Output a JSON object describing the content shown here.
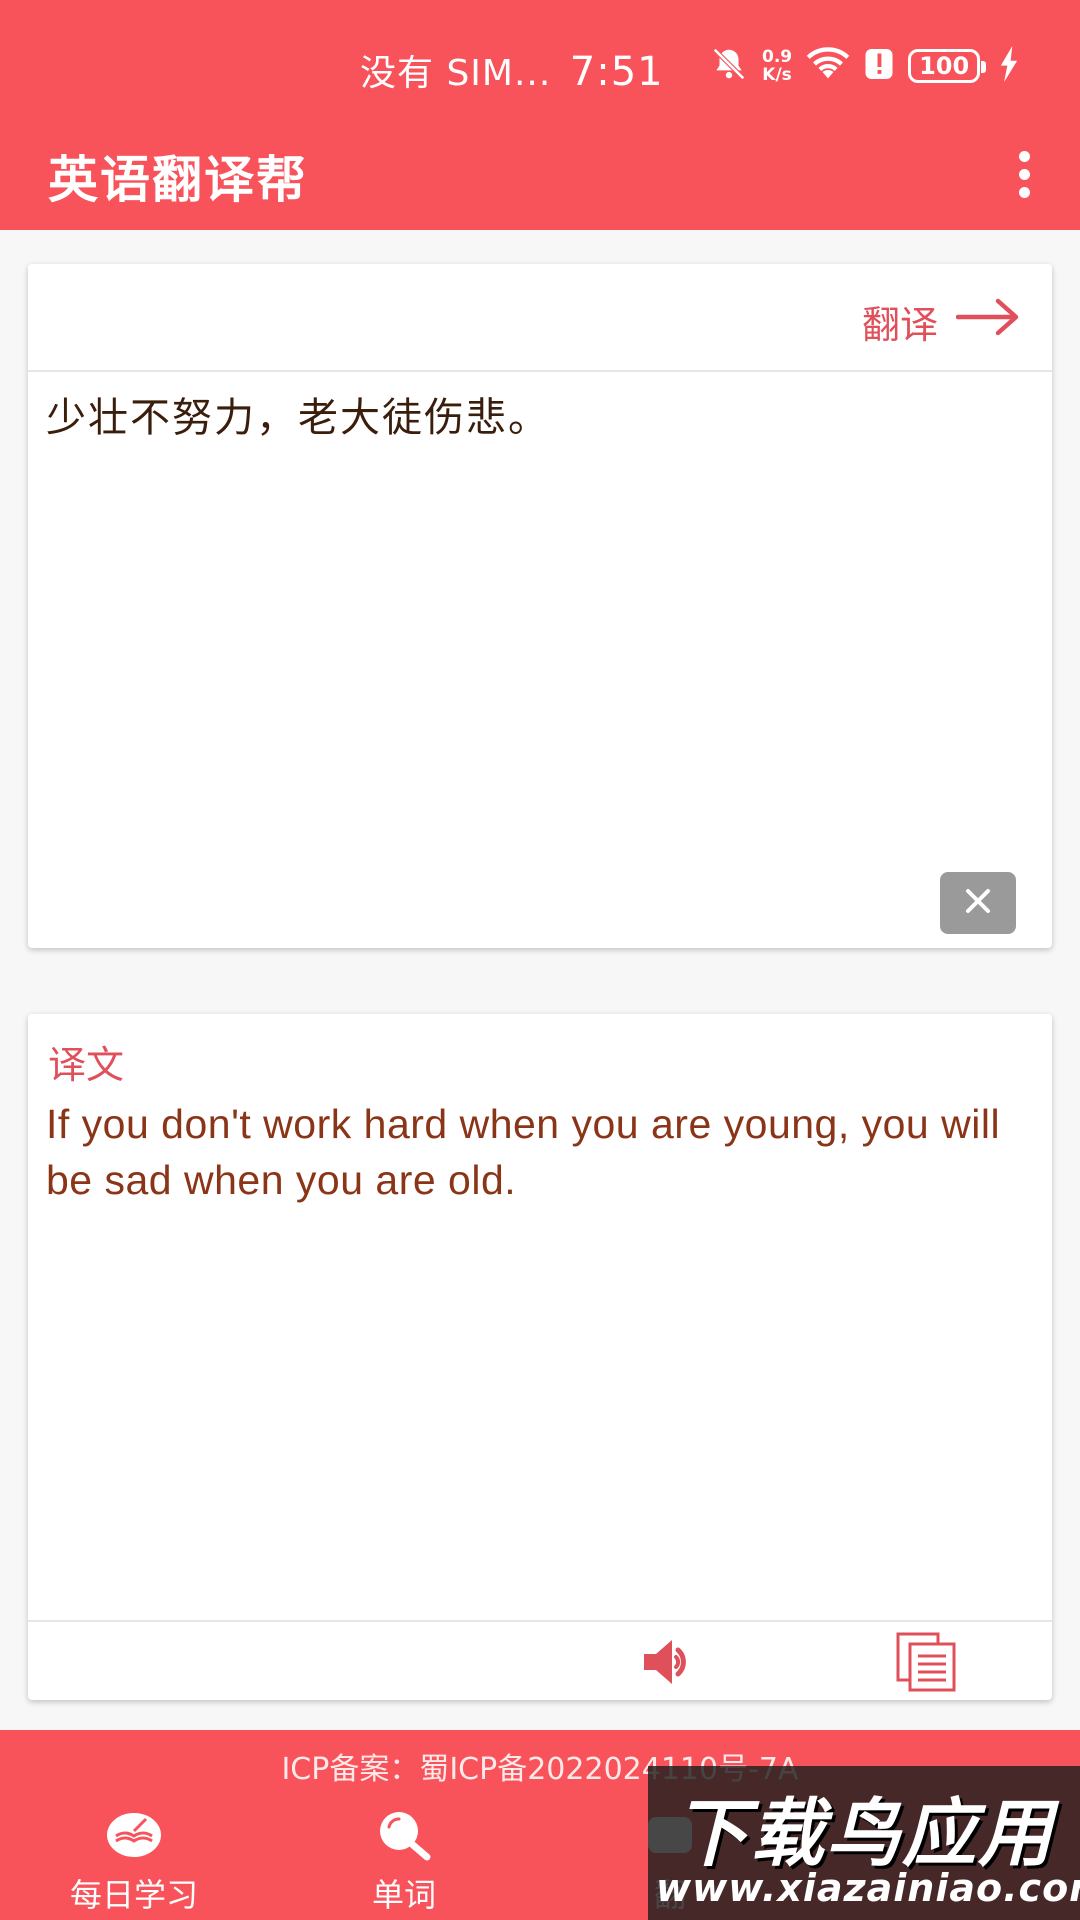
{
  "status_bar": {
    "carrier": "没有 SIM...",
    "time": "7:51",
    "net_speed_value": "0.9",
    "net_speed_unit": "K/s",
    "battery": "100",
    "icons": [
      "bell-off-icon",
      "wifi-icon",
      "alert-icon",
      "battery-icon",
      "charging-icon"
    ]
  },
  "app_bar": {
    "title": "英语翻译帮",
    "menu_icon": "more-vert-icon"
  },
  "input_card": {
    "translate_label": "翻译",
    "source_text": "少壮不努力，老大徒伤悲。",
    "clear_icon": "close-icon"
  },
  "output_card": {
    "label": "译文",
    "text": "If you don't work hard when you are young, you will be sad when you are old.",
    "speak_icon": "speaker-icon",
    "copy_icon": "copy-icon"
  },
  "bottom": {
    "icp": "ICP备案：蜀ICP备2022024110号-7A",
    "nav": [
      {
        "label": "每日学习",
        "icon": "book-icon"
      },
      {
        "label": "单词",
        "icon": "search-icon"
      },
      {
        "label": "翻",
        "icon": "translate-icon"
      }
    ]
  },
  "watermark": {
    "title": "下载鸟应用",
    "url": "www.xiazainiao.com"
  },
  "colors": {
    "primary": "#f8525a",
    "accent_text": "#e0505a",
    "translation_text": "#8a3517",
    "clear_button": "#9a9a9a"
  }
}
